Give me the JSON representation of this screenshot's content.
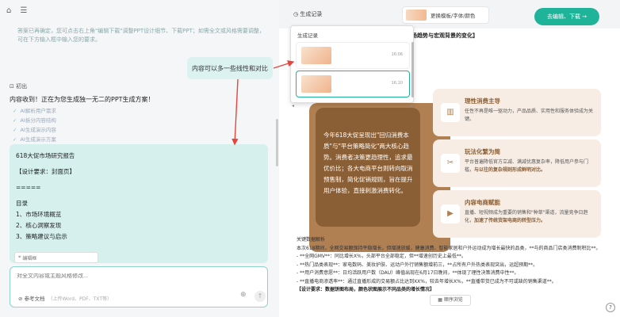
{
  "left": {
    "home_icon": "home-icon",
    "menu_icon": "menu-icon",
    "intro_text": "答案已再确定，您可点击右上角\"编辑下载\"调整PPT设计细节、下载PPT；如需全文或风格需要调整，可在下方输入框中输入您的要求。",
    "user_message": "内容可以多一些线性和对比",
    "edit_label": "初出",
    "gen_title": "内容收到！正在为您生成独一无二的PPT生成方案！",
    "steps": [
      "AI解析用户需求",
      "AI拆分内容结构",
      "AI生成演示内容",
      "AI生成演示方案"
    ],
    "doc": {
      "title": "618大促市场研究报告",
      "design": "【设计要求：封面页】",
      "sep": "=====",
      "toc_title": "目录",
      "toc": [
        "1、市场环境概览",
        "2、核心洞察发现",
        "3、策略建议与启示"
      ]
    },
    "edit_bar": "编辑框",
    "input_placeholder": "对全文内容或主题风格修改...",
    "attach_label": "参考文档",
    "attach_hint": "（上传Word、PDF、TXT等）"
  },
  "right": {
    "history_label": "生成记录",
    "template_label": "更换模板/字体/颜色",
    "download_label": "去编辑、下载 →",
    "slide_title": "市场趋势与宏观背景的变化】",
    "big_text": "今年618大促呈现出\"回归消费本质\"与\"平台策略简化\"两大核心趋势。消费者决策更趋理性，追求最优价比；各大电商平台则转向取消预售制，简化促销规则，旨在提升用户体验，直接刺激消费转化。",
    "features": [
      {
        "icon": "chart-icon",
        "title": "理性消费主导",
        "desc": "任性不再是唯一驱动力，产品品质、实用性和服务体验成为关键。",
        "em": ""
      },
      {
        "icon": "scissors-icon",
        "title": "玩法化繁为简",
        "desc": "平台普遍降低官方立减、满减优惠复杂率，降低用户参与门槛，",
        "em": "与以往的复杂规则形成鲜明对比。"
      },
      {
        "icon": "video-icon",
        "title": "内容电商赋能",
        "desc": "直播、短视频成为重要的销售和\"种草\"渠道，流量竞争日趋化，",
        "em": "加速了传统货架电商的转型压力。"
      }
    ],
    "body_title": "关键数据解析",
    "body_lines": [
      "本次618期间，全网交易额保持平稳增长，但增速放缓，健康消费、智能家居和户外运动成为增长最快的品类，**与的商品门店类消费制积比**。",
      "- **全网GMV**：同比增长X%，头部平台全部稳定，但**增速创历史上最低**。",
      "- **热门品类表现**：家电数码、美妆护肤、运动户外行销售额增前三，**占所有户外热类表现突出，运超预期**。",
      "- **用户消费意愿**：日均活跃用户数（DAU）峰值出现在6月17日晚间，**体现了理性决策消费中性**。",
      "- **直播电商渗透率**：通过直播形成的交易额占比达到XX%，较去年增长X%，**直播带货已成为不可或缺的销售渠道**。"
    ],
    "body_last": "【设计要求：数据饼图布局，颜色状图展示不同品类的增长情况】",
    "zoom_label": "顺序浏览",
    "help_icon": "help-icon"
  },
  "history_popup": {
    "title": "生成记录",
    "items": [
      {
        "time": "16:06"
      },
      {
        "time": "16:10"
      }
    ]
  },
  "colors": {
    "accent": "#1fb39a",
    "bubble": "#dcf2f1",
    "arrow": "#e5453d",
    "brown": "#8a5f35"
  }
}
